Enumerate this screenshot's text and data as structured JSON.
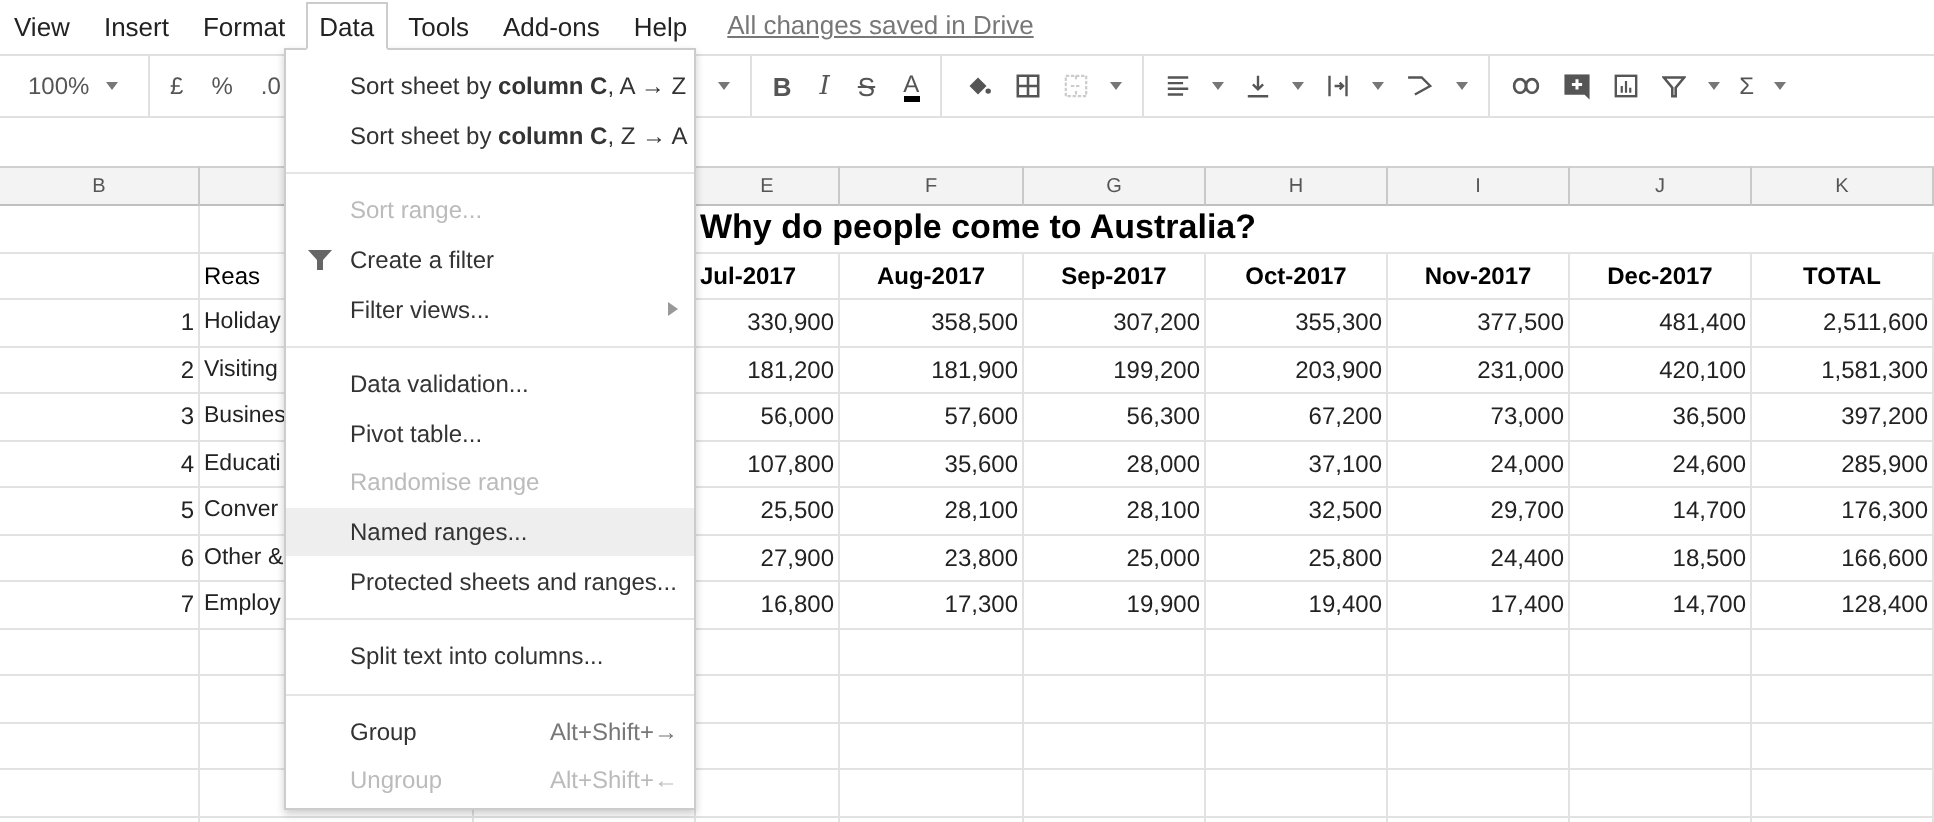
{
  "menu_bar": {
    "items": [
      {
        "label": "View",
        "selected": false
      },
      {
        "label": "Insert",
        "selected": false
      },
      {
        "label": "Format",
        "selected": false
      },
      {
        "label": "Data",
        "selected": true
      },
      {
        "label": "Tools",
        "selected": false
      },
      {
        "label": "Add-ons",
        "selected": false
      },
      {
        "label": "Help",
        "selected": false
      }
    ],
    "save_status": "All changes saved in Drive"
  },
  "toolbar": {
    "groups": [
      [
        {
          "kind": "text",
          "label": "100%"
        },
        {
          "kind": "caret"
        }
      ],
      [
        {
          "kind": "text",
          "label": "£"
        },
        {
          "kind": "text",
          "label": "%"
        },
        {
          "kind": "text",
          "label": ".0"
        }
      ],
      [
        {
          "kind": "caret"
        }
      ],
      [
        {
          "kind": "bold",
          "label": "B"
        },
        {
          "kind": "italic",
          "label": "I"
        },
        {
          "kind": "strike",
          "label": "S"
        },
        {
          "kind": "text-color",
          "label": "A"
        }
      ],
      [
        {
          "kind": "fill"
        },
        {
          "kind": "borders"
        },
        {
          "kind": "merge"
        },
        {
          "kind": "caret"
        }
      ],
      [
        {
          "kind": "align"
        },
        {
          "kind": "caret"
        },
        {
          "kind": "valign"
        },
        {
          "kind": "caret"
        },
        {
          "kind": "wrap"
        },
        {
          "kind": "caret"
        },
        {
          "kind": "rotate"
        },
        {
          "kind": "caret"
        }
      ],
      [
        {
          "kind": "link"
        },
        {
          "kind": "comment"
        },
        {
          "kind": "chart"
        },
        {
          "kind": "filter"
        },
        {
          "kind": "caret"
        },
        {
          "kind": "text",
          "label": "Σ"
        },
        {
          "kind": "caret"
        }
      ]
    ]
  },
  "menu": {
    "sections": [
      [
        {
          "kind": "plain",
          "label": "Sort sheet by **column C**, A → Z",
          "disabled": false,
          "selected": false,
          "submenu": false
        },
        {
          "kind": "plain",
          "label": "Sort sheet by **column C**, Z → A",
          "disabled": false,
          "selected": false,
          "submenu": false
        }
      ],
      [
        {
          "kind": "plain",
          "label": "Sort range...",
          "disabled": true,
          "selected": false,
          "submenu": false
        },
        {
          "kind": "filter",
          "label": "Create a filter",
          "disabled": false,
          "selected": false,
          "submenu": false
        },
        {
          "kind": "plain",
          "label": "Filter views...",
          "disabled": false,
          "selected": false,
          "submenu": true
        }
      ],
      [
        {
          "kind": "plain",
          "label": "Data validation...",
          "disabled": false,
          "selected": false,
          "submenu": false
        },
        {
          "kind": "plain",
          "label": "Pivot table...",
          "disabled": false,
          "selected": false,
          "submenu": false
        },
        {
          "kind": "plain",
          "label": "Randomise range",
          "disabled": true,
          "selected": false,
          "submenu": false
        },
        {
          "kind": "plain",
          "label": "Named ranges...",
          "disabled": false,
          "selected": true,
          "submenu": false
        },
        {
          "kind": "plain",
          "label": "Protected sheets and ranges...",
          "disabled": false,
          "selected": false,
          "submenu": false
        }
      ],
      [
        {
          "kind": "plain",
          "label": "Split text into columns...",
          "disabled": false,
          "selected": false,
          "submenu": false
        }
      ],
      [
        {
          "kind": "plain",
          "label": "Group",
          "shortcut": "Alt+Shift+→",
          "disabled": false,
          "selected": false,
          "submenu": false
        },
        {
          "kind": "plain",
          "label": "Ungroup",
          "shortcut": "Alt+Shift+←",
          "disabled": true,
          "selected": false,
          "submenu": false
        }
      ]
    ]
  },
  "sheet": {
    "column_headers": {
      "left": "B",
      "right": [
        "E",
        "F",
        "G",
        "H",
        "I",
        "J",
        "K"
      ]
    },
    "title": "Why do people come to Australia?",
    "header": {
      "reason": "Reas",
      "months": [
        "Jul-2017",
        "Aug-2017",
        "Sep-2017",
        "Oct-2017",
        "Nov-2017",
        "Dec-2017",
        "TOTAL"
      ]
    },
    "rows": [
      {
        "number": "1",
        "reason": "Holiday",
        "values": [
          "330,900",
          "358,500",
          "307,200",
          "355,300",
          "377,500",
          "481,400",
          "2,511,600"
        ]
      },
      {
        "number": "2",
        "reason": "Visiting",
        "values": [
          "181,200",
          "181,900",
          "199,200",
          "203,900",
          "231,000",
          "420,100",
          "1,581,300"
        ]
      },
      {
        "number": "3",
        "reason": "Busines",
        "values": [
          "56,000",
          "57,600",
          "56,300",
          "67,200",
          "73,000",
          "36,500",
          "397,200"
        ]
      },
      {
        "number": "4",
        "reason": "Educati",
        "values": [
          "107,800",
          "35,600",
          "28,000",
          "37,100",
          "24,000",
          "24,600",
          "285,900"
        ]
      },
      {
        "number": "5",
        "reason": "Conver",
        "values": [
          "25,500",
          "28,100",
          "28,100",
          "32,500",
          "29,700",
          "14,700",
          "176,300"
        ]
      },
      {
        "number": "6",
        "reason": "Other &",
        "values": [
          "27,900",
          "23,800",
          "25,000",
          "25,800",
          "24,400",
          "18,500",
          "166,600"
        ]
      },
      {
        "number": "7",
        "reason": "Employ",
        "values": [
          "16,800",
          "17,300",
          "19,900",
          "19,400",
          "17,400",
          "14,700",
          "128,400"
        ]
      }
    ]
  }
}
